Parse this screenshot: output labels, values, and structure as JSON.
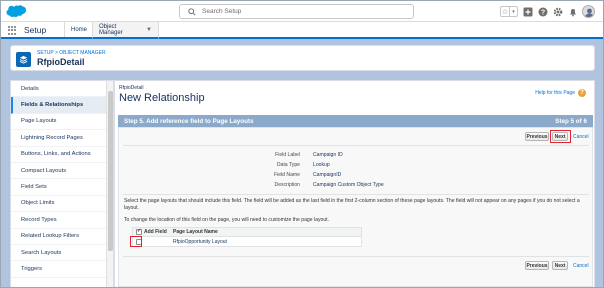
{
  "colors": {
    "brand": "#00a1e0",
    "link": "#0070d2",
    "step_bar": "#8aa9cb",
    "highlight": "#e0242f"
  },
  "topbar": {
    "search_placeholder": "Search Setup",
    "icons": [
      "star-icon",
      "chevron-down-icon",
      "plus-icon",
      "help-icon",
      "gear-icon",
      "bell-icon",
      "avatar"
    ]
  },
  "nav": {
    "app_name": "Setup",
    "tabs": [
      {
        "label": "Home"
      },
      {
        "label": "Object Manager"
      }
    ]
  },
  "header": {
    "breadcrumb": "SETUP > OBJECT MANAGER",
    "title": "RfpioDetail"
  },
  "sidebar": {
    "items": [
      {
        "label": "Details"
      },
      {
        "label": "Fields & Relationships"
      },
      {
        "label": "Page Layouts"
      },
      {
        "label": "Lightning Record Pages"
      },
      {
        "label": "Buttons, Links, and Actions"
      },
      {
        "label": "Compact Layouts"
      },
      {
        "label": "Field Sets"
      },
      {
        "label": "Object Limits"
      },
      {
        "label": "Record Types"
      },
      {
        "label": "Related Lookup Filters"
      },
      {
        "label": "Search Layouts"
      },
      {
        "label": "Triggers"
      }
    ],
    "active": "Fields & Relationships"
  },
  "main": {
    "object_name": "RfpioDetail",
    "page_title": "New Relationship",
    "help_link": "Help for this Page",
    "step_title": "Step 5. Add reference field to Page Layouts",
    "step_counter": "Step 5 of 6",
    "buttons": {
      "previous": "Previous",
      "next": "Next",
      "cancel": "Cancel"
    },
    "fields": [
      {
        "label": "Field Label",
        "value": "Campaign ID"
      },
      {
        "label": "Data Type",
        "value": "Lookup"
      },
      {
        "label": "Field Name",
        "value": "CampaignID"
      },
      {
        "label": "Description",
        "value": "Campaign Custom Object Type"
      }
    ],
    "instructions": "Select the page layouts that should include this field. The field will be added as the last field in the first 2-column section of these page layouts. The field will not appear on any pages if you do not select a layout.",
    "instructions2": "To change the location of this field on the page, you will need to customize the page layout.",
    "table": {
      "headers": {
        "add_field": "Add Field",
        "layout_name": "Page Layout Name"
      },
      "rows": [
        {
          "name": "RfpioOpportunity Layout",
          "checked": false
        }
      ]
    }
  }
}
